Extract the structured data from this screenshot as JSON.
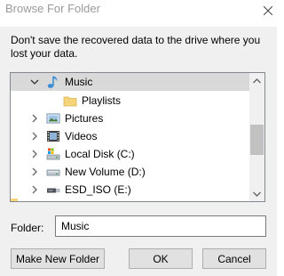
{
  "window": {
    "title": "Browse For Folder",
    "close_icon": "close-icon"
  },
  "instruction": "Don't save the recovered data to the drive where you lost your data.",
  "tree": {
    "items": [
      {
        "label": "Music",
        "icon": "music-note-icon",
        "expander": "expanded",
        "selected": true
      },
      {
        "label": "Playlists",
        "icon": "folder-icon",
        "expander": "none",
        "selected": false
      },
      {
        "label": "Pictures",
        "icon": "pictures-icon",
        "expander": "collapsed",
        "selected": false
      },
      {
        "label": "Videos",
        "icon": "videos-icon",
        "expander": "collapsed",
        "selected": false
      },
      {
        "label": "Local Disk (C:)",
        "icon": "local-disk-icon",
        "expander": "collapsed",
        "selected": false
      },
      {
        "label": "New Volume (D:)",
        "icon": "drive-icon",
        "expander": "collapsed",
        "selected": false
      },
      {
        "label": "ESD_ISO (E:)",
        "icon": "usb-drive-icon",
        "expander": "collapsed",
        "selected": false
      }
    ]
  },
  "folder": {
    "label": "Folder:",
    "value": "Music"
  },
  "buttons": {
    "new_folder": "Make New Folder",
    "ok": "OK",
    "cancel": "Cancel"
  },
  "colors": {
    "selection": "#d9d9d9",
    "music_icon": "#3c8fd6",
    "folder_icon": "#f5d47a"
  }
}
